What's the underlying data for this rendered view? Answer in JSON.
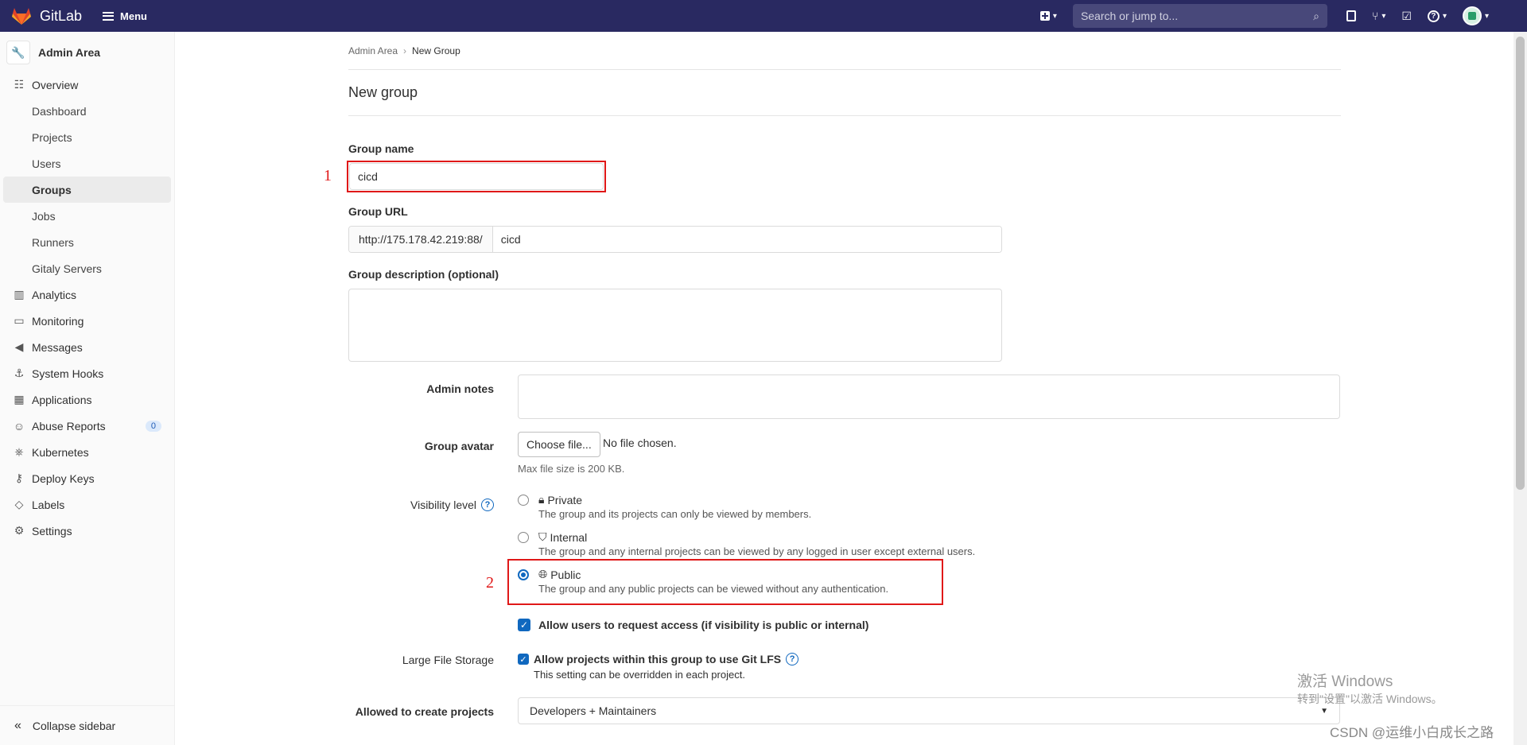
{
  "navbar": {
    "brand": "GitLab",
    "menu_label": "Menu",
    "search_placeholder": "Search or jump to...",
    "bg_color": "#292961"
  },
  "sidebar": {
    "title": "Admin Area",
    "overview_label": "Overview",
    "sub_items": [
      "Dashboard",
      "Projects",
      "Users",
      "Groups",
      "Jobs",
      "Runners",
      "Gitaly Servers"
    ],
    "active_item": "Groups",
    "sections": [
      {
        "label": "Analytics",
        "icon": "chart-icon"
      },
      {
        "label": "Monitoring",
        "icon": "monitor-icon"
      },
      {
        "label": "Messages",
        "icon": "bullhorn-icon"
      },
      {
        "label": "System Hooks",
        "icon": "hook-icon"
      },
      {
        "label": "Applications",
        "icon": "grid-icon"
      },
      {
        "label": "Abuse Reports",
        "icon": "smiley-icon",
        "badge": "0"
      },
      {
        "label": "Kubernetes",
        "icon": "kubernetes-icon"
      },
      {
        "label": "Deploy Keys",
        "icon": "key-icon"
      },
      {
        "label": "Labels",
        "icon": "label-icon"
      },
      {
        "label": "Settings",
        "icon": "gear-icon"
      }
    ],
    "collapse_label": "Collapse sidebar"
  },
  "breadcrumb": {
    "parent": "Admin Area",
    "current": "New Group"
  },
  "page_title": "New group",
  "form": {
    "group_name_label": "Group name",
    "group_name_value": "cicd",
    "group_url_label": "Group URL",
    "group_url_prefix": "http://175.178.42.219:88/",
    "group_url_value": "cicd",
    "description_label": "Group description (optional)",
    "admin_notes_label": "Admin notes",
    "avatar_label": "Group avatar",
    "choose_file_label": "Choose file...",
    "no_file_text": "No file chosen.",
    "max_file_size": "Max file size is 200 KB.",
    "visibility_label": "Visibility level",
    "visibility_options": [
      {
        "title": "Private",
        "desc": "The group and its projects can only be viewed by members.",
        "icon": "lock-icon",
        "checked": false
      },
      {
        "title": "Internal",
        "desc": "The group and any internal projects can be viewed by any logged in user except external users.",
        "icon": "shield-icon",
        "checked": false
      },
      {
        "title": "Public",
        "desc": "The group and any public projects can be viewed without any authentication.",
        "icon": "globe-icon",
        "checked": true
      }
    ],
    "request_access_label": "Allow users to request access (if visibility is public or internal)",
    "lfs_label": "Large File Storage",
    "lfs_checkbox_label": "Allow projects within this group to use Git LFS",
    "lfs_help": "This setting can be overridden in each project.",
    "allowed_create_label": "Allowed to create projects",
    "allowed_create_value": "Developers + Maintainers"
  },
  "annotations": {
    "one": "1",
    "two": "2",
    "color": "#e01818"
  },
  "watermark": {
    "windows_title": "激活 Windows",
    "windows_sub": "转到\"设置\"以激活 Windows。",
    "csdn": "CSDN @运维小白成长之路"
  }
}
